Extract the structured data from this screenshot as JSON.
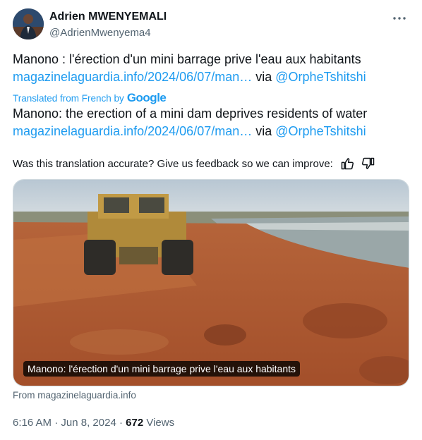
{
  "author": {
    "name": "Adrien MWENYEMALI",
    "handle": "@AdrienMwenyema4"
  },
  "tweet": {
    "original_text": "Manono : l'érection d'un mini barrage prive l'eau aux habitants",
    "original_link": "magazinelaguardia.info/2024/06/07/man…",
    "via": "via",
    "mention": "@OrpheTshitshi",
    "translated_label": "Translated from French by",
    "translator_brand": "Google",
    "translated_text": "Manono: the erection of a mini dam deprives residents of water",
    "translated_link": "magazinelaguardia.info/2024/06/07/man…",
    "feedback_question": "Was this translation accurate? Give us feedback so we can improve:"
  },
  "media": {
    "caption": "Manono: l'érection d'un mini barrage prive l'eau aux habitants",
    "source": "From magazinelaguardia.info"
  },
  "meta": {
    "time": "6:16 AM",
    "date": "Jun 8, 2024",
    "views_count": "672",
    "views_label": "Views"
  },
  "icons": [
    "more-icon",
    "thumbs-up-icon",
    "thumbs-down-icon"
  ],
  "colors": {
    "link": "#1d9bf0",
    "muted": "#536471",
    "text": "#0f1419"
  }
}
